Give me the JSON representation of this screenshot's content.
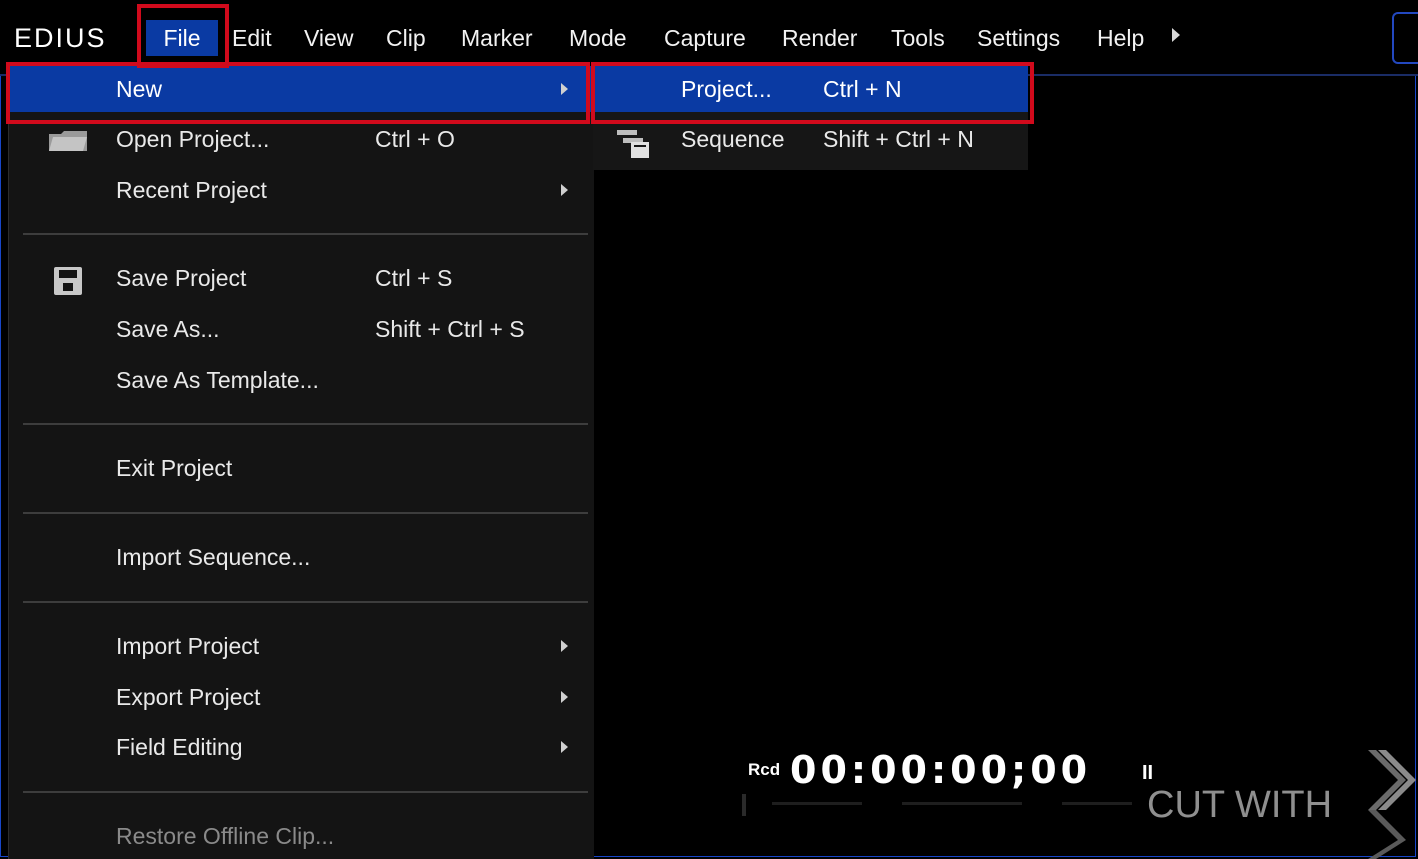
{
  "app": {
    "logo": "EDIUS"
  },
  "menubar": {
    "items": [
      "File",
      "Edit",
      "View",
      "Clip",
      "Marker",
      "Mode",
      "Capture",
      "Render",
      "Tools",
      "Settings",
      "Help"
    ]
  },
  "file_menu": {
    "new": {
      "label": "New"
    },
    "open_project": {
      "label": "Open Project...",
      "shortcut": "Ctrl + O"
    },
    "recent_project": {
      "label": "Recent Project"
    },
    "save_project": {
      "label": "Save Project",
      "shortcut": "Ctrl + S"
    },
    "save_as": {
      "label": "Save As...",
      "shortcut": "Shift + Ctrl + S"
    },
    "save_as_template": {
      "label": "Save As Template..."
    },
    "exit_project": {
      "label": "Exit Project"
    },
    "import_sequence": {
      "label": "Import Sequence..."
    },
    "import_project": {
      "label": "Import Project"
    },
    "export_project": {
      "label": "Export Project"
    },
    "field_editing": {
      "label": "Field Editing"
    },
    "restore_offline_clip": {
      "label": "Restore Offline Clip..."
    }
  },
  "new_submenu": {
    "project": {
      "label": "Project...",
      "shortcut": "Ctrl + N"
    },
    "sequence": {
      "label": "Sequence",
      "shortcut": "Shift + Ctrl + N"
    }
  },
  "player": {
    "rcd_label": "Rcd",
    "timecode": "00:00:00;00",
    "pause_symbol": "II",
    "watermark": "CUT WITH"
  },
  "colors": {
    "highlight": "#0a3aa3",
    "annotation_red": "#d10a1c",
    "background": "#000000"
  }
}
